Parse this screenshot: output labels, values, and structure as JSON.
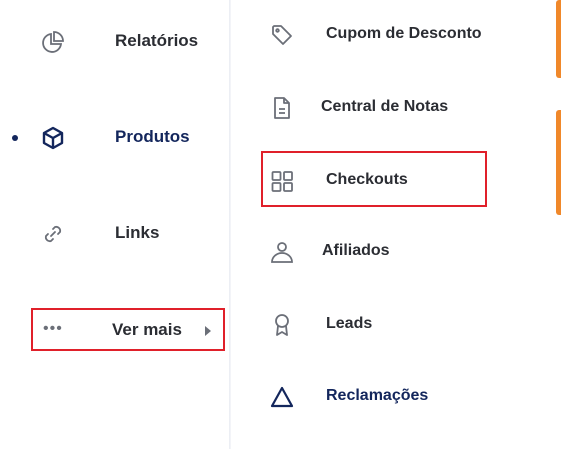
{
  "sidebar": {
    "items": [
      {
        "label": "Relatórios",
        "icon": "pie-chart-icon"
      },
      {
        "label": "Produtos",
        "icon": "cube-icon",
        "active": true
      },
      {
        "label": "Links",
        "icon": "link-icon"
      }
    ],
    "more": {
      "dots": "•••",
      "label": "Ver mais",
      "icon": "caret-right-icon"
    }
  },
  "submenu": {
    "items": [
      {
        "label": "Cupom de Desconto",
        "icon": "tag-icon"
      },
      {
        "label": "Central de Notas",
        "icon": "document-icon"
      },
      {
        "label": "Checkouts",
        "icon": "grid-icon"
      },
      {
        "label": "Afiliados",
        "icon": "user-icon"
      },
      {
        "label": "Leads",
        "icon": "award-icon"
      },
      {
        "label": "Reclamações",
        "icon": "triangle-icon"
      }
    ]
  },
  "colors": {
    "accent": "#f0882a",
    "active": "#13265c",
    "highlight_border": "#e0202a"
  }
}
